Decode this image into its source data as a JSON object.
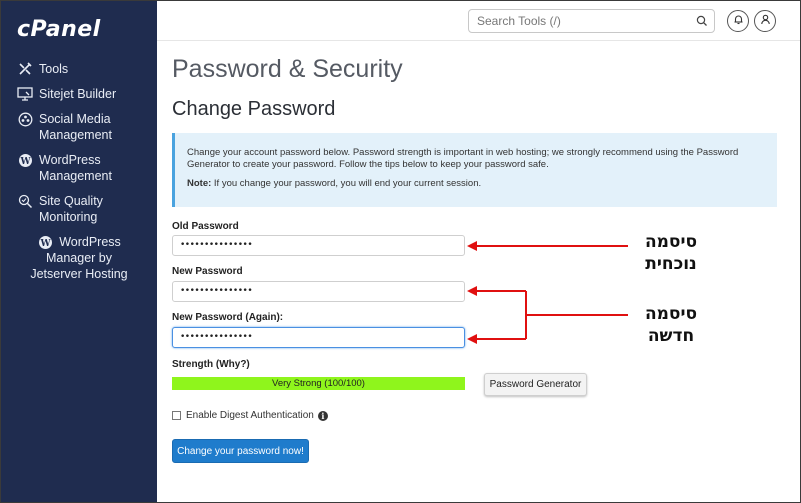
{
  "sidebar": {
    "logo": "cPanel",
    "items": [
      {
        "label": "Tools",
        "icon": "tools-icon"
      },
      {
        "label": "Sitejet Builder",
        "icon": "monitor-icon"
      },
      {
        "label": "Social Media\nManagement",
        "icon": "social-icon"
      },
      {
        "label": "WordPress\nManagement",
        "icon": "wordpress-icon"
      },
      {
        "label": "Site Quality\nMonitoring",
        "icon": "search-check-icon"
      },
      {
        "label": "WordPress",
        "label2": "Manager by\nJetserver Hosting",
        "icon": "wordpress-icon"
      }
    ]
  },
  "topbar": {
    "search_placeholder": "Search Tools (/)",
    "icons": [
      "search-icon",
      "bell-icon",
      "user-icon"
    ]
  },
  "page": {
    "title": "Password & Security",
    "section_title": "Change Password",
    "info_text": "Change your account password below. Password strength is important in web hosting; we strongly recommend using the Password Generator to create your password. Follow the tips below to keep your password safe.",
    "note_label": "Note:",
    "note_text": " If you change your password, you will end your current session."
  },
  "form": {
    "old_password_label": "Old Password",
    "old_password_value": "•••••••••••••••",
    "new_password_label": "New Password",
    "new_password_value": "•••••••••••••••",
    "new_password_again_label": "New Password (Again):",
    "new_password_again_value": "•••••••••••••••",
    "strength_label": "Strength (Why?)",
    "strength_text": "Very Strong (100/100)",
    "strength_percent": 100,
    "password_generator_label": "Password Generator",
    "digest_label": "Enable Digest Authentication",
    "digest_checked": false,
    "submit_label": "Change your password now!"
  },
  "annotations": {
    "current_password": "סיסמה\nנוכחית",
    "new_password": "סיסמה\nחדשה"
  },
  "colors": {
    "sidebar_bg": "#1f2c4f",
    "primary_button": "#1f7ccc",
    "strength_bar": "#8ff51c",
    "info_bg": "#e3f1fa",
    "annotation_arrow": "#e01010"
  }
}
